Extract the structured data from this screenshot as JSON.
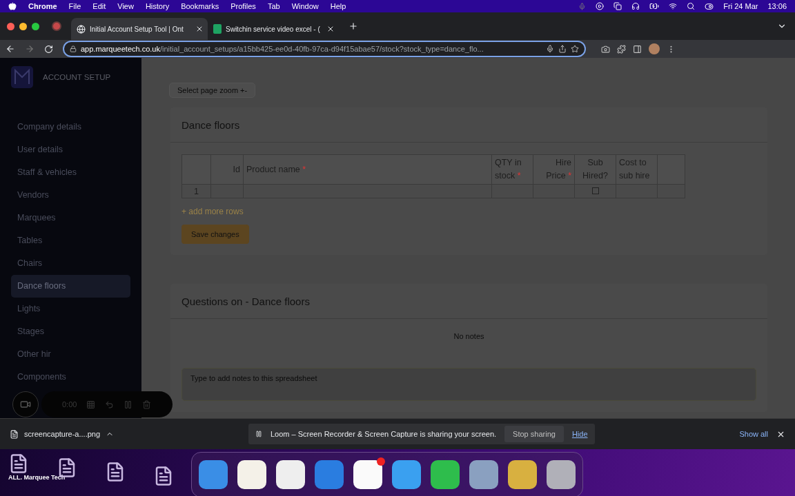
{
  "menubar": {
    "app": "Chrome",
    "items": [
      "File",
      "Edit",
      "View",
      "History",
      "Bookmarks",
      "Profiles",
      "Tab",
      "Window",
      "Help"
    ],
    "date": "Fri 24 Mar",
    "time": "13:06"
  },
  "tabs": [
    {
      "title": "Initial Account Setup Tool | Ont",
      "kind": "globe",
      "selected": true
    },
    {
      "title": "Switchin service video excel - (",
      "kind": "sheet",
      "selected": false
    }
  ],
  "address": {
    "host": "app.marqueetech.co.uk",
    "path": "/initial_account_setups/a15bb425-ee0d-40fb-97ca-d94f15abae57/stock?stock_type=dance_flo..."
  },
  "sidebar": {
    "brand": "ACCOUNT SETUP",
    "items": [
      {
        "label": "Company details",
        "selected": false
      },
      {
        "label": "User details",
        "selected": false
      },
      {
        "label": "Staff & vehicles",
        "selected": false
      },
      {
        "label": "Vendors",
        "selected": false
      },
      {
        "label": "Marquees",
        "selected": false
      },
      {
        "label": "Tables",
        "selected": false
      },
      {
        "label": "Chairs",
        "selected": false
      },
      {
        "label": "Dance floors",
        "selected": true
      },
      {
        "label": "Lights",
        "selected": false
      },
      {
        "label": "Stages",
        "selected": false
      },
      {
        "label": "Other hir",
        "selected": false
      },
      {
        "label": "Components",
        "selected": false
      }
    ]
  },
  "zoom_select": "Select page zoom +-",
  "stock": {
    "title": "Dance floors",
    "columns": [
      {
        "label": "Id",
        "kind": "number"
      },
      {
        "label": "Product name",
        "mark": "*",
        "kind": "text"
      },
      {
        "label": "QTY in stock",
        "mark": "*",
        "kind": "text"
      },
      {
        "label": "Hire Price",
        "mark": "*",
        "kind": "number"
      },
      {
        "label": "Sub Hired?",
        "kind": "checkbox"
      },
      {
        "label": "Cost to sub hire",
        "kind": "text"
      }
    ],
    "rows": [
      {
        "index": "1",
        "sub_hired": false
      }
    ],
    "add_rows": "+ add more rows",
    "save": "Save changes"
  },
  "questions": {
    "title": "Questions on - Dance floors",
    "empty": "No notes",
    "placeholder": "Type to add notes to this spreadsheet"
  },
  "recorder": {
    "time": "0:00"
  },
  "download_bar": {
    "file": "screencapture-a....png",
    "notice": "Loom – Screen Recorder & Screen Capture is sharing your screen.",
    "stop": "Stop sharing",
    "hide": "Hide",
    "show_all": "Show all"
  },
  "desktop": {
    "file_label": "ALL. Marquee Tech"
  }
}
